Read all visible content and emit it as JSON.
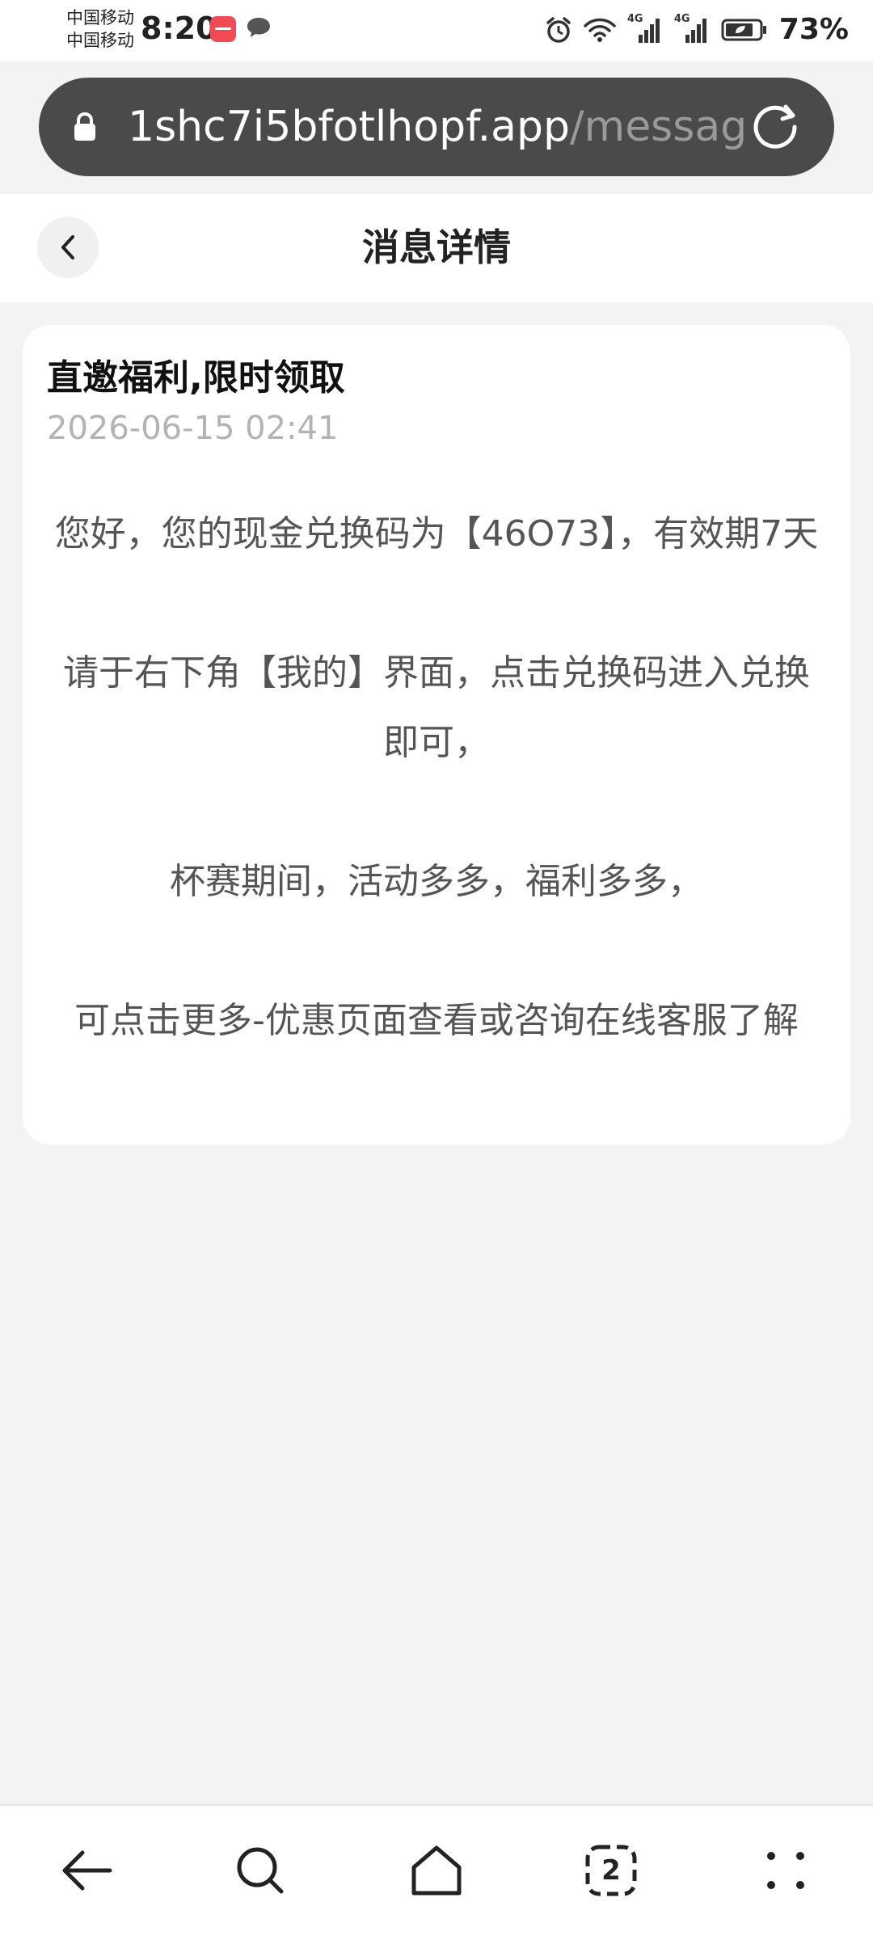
{
  "status_bar": {
    "carrier_1": "中国移动",
    "carrier_2": "中国移动",
    "time": "8:20",
    "network_1": "4G",
    "network_2": "4G",
    "battery": "73%"
  },
  "browser": {
    "url_domain": "1shc7i5bfotlhopf.app",
    "url_path": "/messag",
    "tab_count": "2"
  },
  "header": {
    "title": "消息详情"
  },
  "message": {
    "title": "直邀福利,限时领取",
    "time": "2026-06-15 02:41",
    "paragraphs": [
      "您好，您的现金兑换码为【46O73】，有效期7天",
      "请于右下角【我的】界面，点击兑换码进入兑换即可，",
      "杯赛期间，活动多多，福利多多，",
      "可点击更多-优惠页面查看或咨询在线客服了解"
    ]
  },
  "icons": {
    "lock": "lock-icon",
    "reload": "reload-icon",
    "back": "chevron-left-icon",
    "nav_back": "arrow-left-icon",
    "nav_search": "search-icon",
    "nav_home": "home-icon",
    "nav_tabs": "tabs-icon",
    "nav_menu": "menu-dots-icon"
  },
  "colors": {
    "address_bar": "#4a4a4a",
    "page_background": "#f3f3f3",
    "card": "#ffffff",
    "timestamp": "#b3b3b3"
  }
}
